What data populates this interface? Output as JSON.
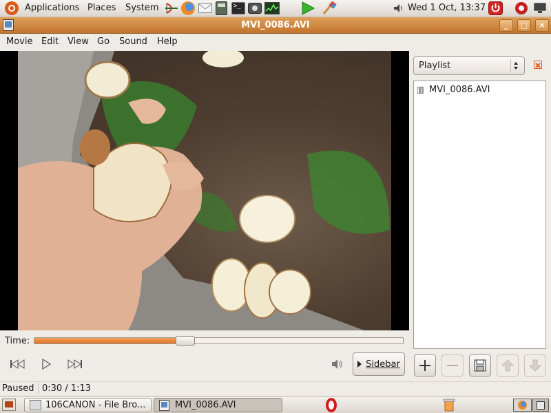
{
  "top_panel": {
    "menus": [
      "Applications",
      "Places",
      "System"
    ],
    "clock": "Wed  1 Oct, 13:37"
  },
  "window": {
    "title": "MVI_0086.AVI",
    "buttons": [
      "minimize",
      "maximize",
      "close"
    ]
  },
  "menubar": [
    "Movie",
    "Edit",
    "View",
    "Go",
    "Sound",
    "Help"
  ],
  "player": {
    "time_label": "Time:",
    "progress_fraction": 0.41,
    "sidebar_label": "Sidebar"
  },
  "sidebar": {
    "dropdown_value": "Playlist",
    "items": [
      {
        "name": "MVI_0086.AVI"
      }
    ],
    "buttons": [
      "add",
      "remove",
      "save",
      "move-up",
      "move-down"
    ]
  },
  "status": {
    "state": "Paused",
    "time": "0:30 / 1:13"
  },
  "taskbar": {
    "tasks": [
      {
        "label": "106CANON - File Bro..."
      },
      {
        "label": "MVI_0086.AVI"
      }
    ]
  },
  "colors": {
    "titlebar": "#c98035",
    "progress": "#e8843a",
    "close_accent": "#e05a1a"
  }
}
